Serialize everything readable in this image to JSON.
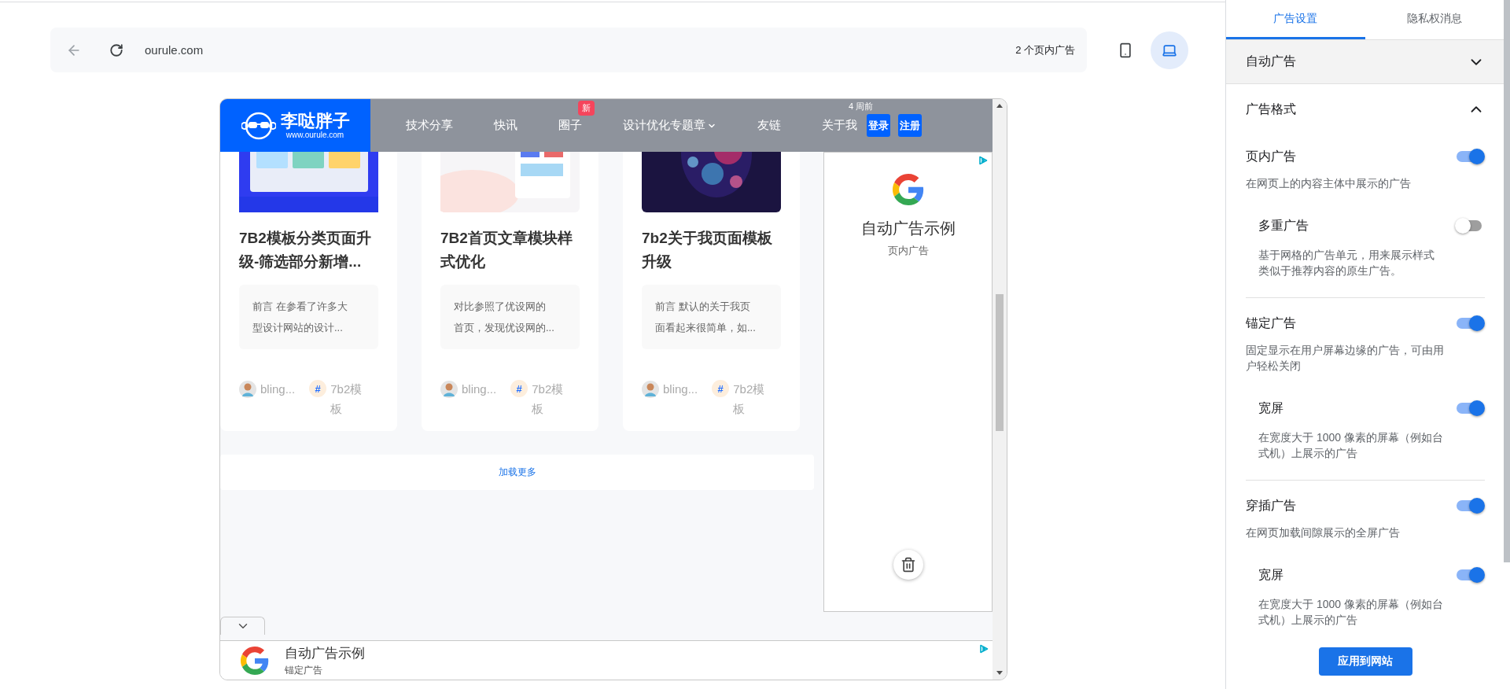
{
  "toolbar": {
    "url": "ourule.com",
    "ad_count": "2 个页内广告",
    "devices": [
      {
        "kind": "phone",
        "selected": false
      },
      {
        "kind": "laptop",
        "selected": true
      }
    ]
  },
  "preview": {
    "site_header": {
      "logo_title": "李哒胖子",
      "logo_url": "www.ourule.com",
      "nav": [
        {
          "label": "技术分享",
          "dropdown": false
        },
        {
          "label": "快讯",
          "dropdown": false
        },
        {
          "label": "圈子",
          "dropdown": false,
          "badge": "新"
        },
        {
          "label": "设计优化专题章",
          "dropdown": true
        },
        {
          "label": "友链",
          "dropdown": false
        },
        {
          "label": "关于我",
          "dropdown": false
        }
      ],
      "buttons": [
        "登录",
        "注册"
      ]
    },
    "cards": [
      {
        "title_lines": [
          "7B2模板分类页面升",
          "级-筛选部分新增..."
        ],
        "excerpt_lines": [
          "前言 在参看了许多大",
          "型设计网站的设计..."
        ],
        "author": "bling...",
        "tag_symbol": "#",
        "tag_lines": [
          "7b2模",
          "板"
        ]
      },
      {
        "title_lines": [
          "7B2首页文章模块样",
          "式优化"
        ],
        "excerpt_lines": [
          "对比参照了优设网的",
          "首页，发现优设网的..."
        ],
        "author": "bling...",
        "tag_symbol": "#",
        "tag_lines": [
          "7b2模",
          "板"
        ]
      },
      {
        "title_lines": [
          "7b2关于我页面模板",
          "升级"
        ],
        "excerpt_lines": [
          "前言 默认的关于我页",
          "面看起来很简单，如..."
        ],
        "author": "bling...",
        "tag_symbol": "#",
        "tag_lines": [
          "7b2模",
          "板"
        ]
      }
    ],
    "load_more": "加载更多",
    "sidebar_post_time": "4 周前",
    "inline_ad": {
      "title": "自动广告示例",
      "subtitle": "页内广告"
    },
    "anchor_ad": {
      "title": "自动广告示例",
      "subtitle": "锚定广告"
    }
  },
  "panel": {
    "tabs": [
      {
        "label": "广告设置",
        "selected": true
      },
      {
        "label": "隐私权消息",
        "selected": false
      }
    ],
    "sections": [
      {
        "title": "自动广告",
        "expanded": false
      },
      {
        "title": "广告格式",
        "expanded": true,
        "formats": [
          {
            "title": "页内广告",
            "on": true,
            "description_lines": [
              "在网页上的内容主体中展示的广告"
            ],
            "options": [
              {
                "title": "多重广告",
                "on": false,
                "description_lines": [
                  "基于网格的广告单元，用来展示样式",
                  "类似于推荐内容的原生广告。"
                ]
              }
            ]
          },
          {
            "title": "锚定广告",
            "on": true,
            "description_lines": [
              "固定显示在用户屏幕边缘的广告，可由用",
              "户轻松关闭"
            ],
            "options": [
              {
                "title": "宽屏",
                "on": true,
                "description_lines": [
                  "在宽度大于 1000 像素的屏幕（例如台",
                  "式机）上展示的广告"
                ]
              }
            ]
          },
          {
            "title": "穿插广告",
            "on": true,
            "description_lines": [
              "在网页加载间隙展示的全屏广告"
            ],
            "options": [
              {
                "title": "宽屏",
                "on": true,
                "description_lines": [
                  "在宽度大于 1000 像素的屏幕（例如台",
                  "式机）上展示的广告"
                ]
              }
            ]
          }
        ]
      }
    ],
    "apply_button": "应用到网站"
  }
}
